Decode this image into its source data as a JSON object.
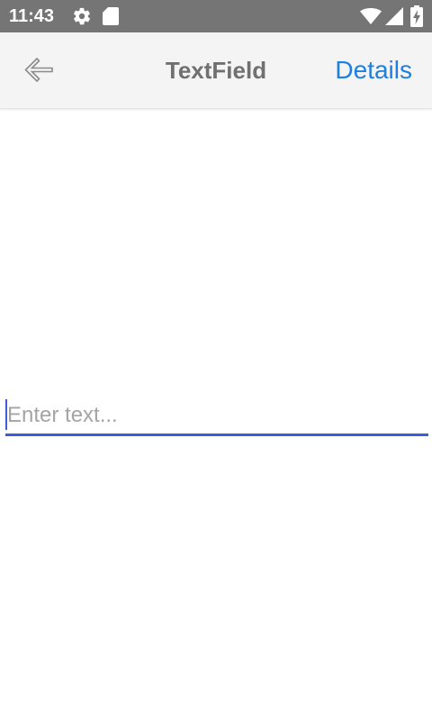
{
  "status_bar": {
    "time": "11:43",
    "icons": [
      "gear-icon",
      "sd-card-icon",
      "wifi-icon",
      "cell-signal-icon",
      "battery-charging-icon"
    ],
    "background": "#757575"
  },
  "app_bar": {
    "back_icon": "arrow-left-icon",
    "title": "TextField",
    "details_label": "Details",
    "accent": "#1e7fe0"
  },
  "text_field": {
    "value": "",
    "placeholder": "Enter text...",
    "underline_color": "#3f5bd8"
  }
}
